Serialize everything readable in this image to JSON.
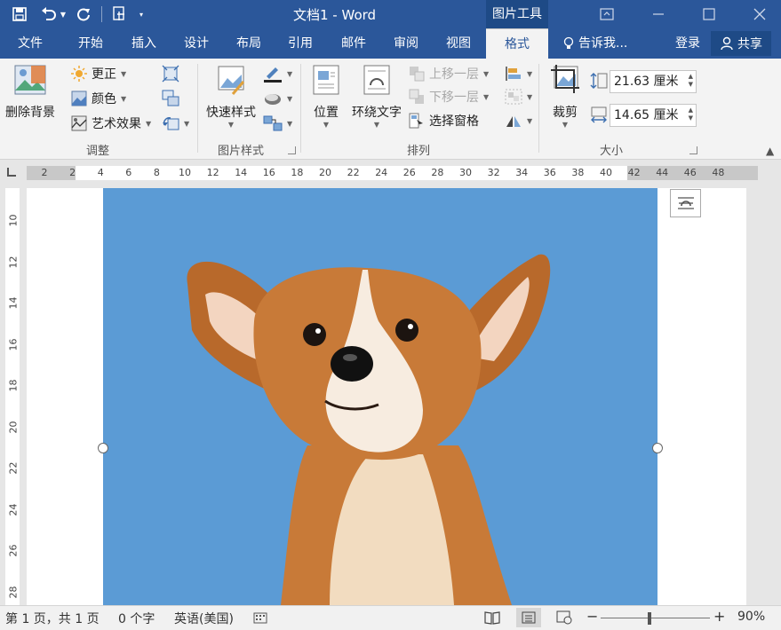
{
  "window": {
    "doc_title": "文档1 - Word",
    "contextual_tab": "图片工具",
    "colors": {
      "titlebar": "#2b579a",
      "contextual": "#1e4a86",
      "picture_bg": "#5b9bd5"
    }
  },
  "tabs": [
    "文件",
    "开始",
    "插入",
    "设计",
    "布局",
    "引用",
    "邮件",
    "审阅",
    "视图",
    "格式"
  ],
  "active_tab": "格式",
  "tell_me": "告诉我...",
  "login": "登录",
  "share": "共享",
  "ribbon": {
    "adjust": {
      "label": "调整",
      "remove_bg": "删除背景",
      "corrections": "更正",
      "color": "颜色",
      "artistic": "艺术效果"
    },
    "styles": {
      "label": "图片样式",
      "quick_styles": "快速样式"
    },
    "arrange": {
      "label": "排列",
      "position": "位置",
      "wrap_text": "环绕文字",
      "bring_forward": "上移一层",
      "send_backward": "下移一层",
      "selection_pane": "选择窗格"
    },
    "size": {
      "label": "大小",
      "crop": "裁剪",
      "height": "21.63 厘米",
      "width": "14.65 厘米"
    }
  },
  "ruler": {
    "horizontal": [
      "2",
      "2",
      "4",
      "6",
      "8",
      "10",
      "12",
      "14",
      "16",
      "18",
      "20",
      "22",
      "24",
      "26",
      "28",
      "30",
      "32",
      "34",
      "36",
      "38",
      "40",
      "42",
      "44",
      "46",
      "48"
    ],
    "vertical": [
      "10",
      "12",
      "14",
      "16",
      "18",
      "20",
      "22",
      "24",
      "26",
      "28"
    ]
  },
  "status": {
    "page": "第 1 页，共 1 页",
    "words": "0 个字",
    "language": "英语(美国)",
    "zoom": "90%",
    "zoom_level": 0.9
  }
}
